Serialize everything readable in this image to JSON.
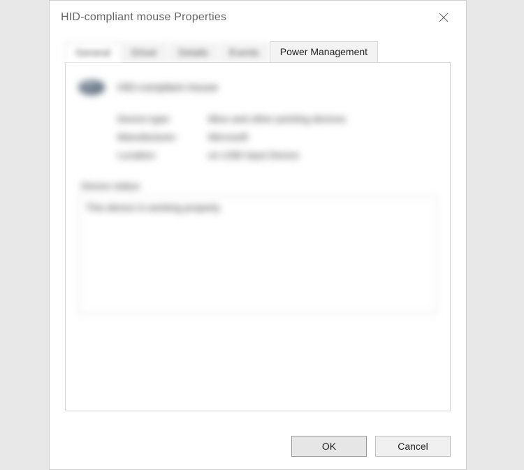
{
  "dialog": {
    "title": "HID-compliant mouse Properties"
  },
  "tabs": [
    {
      "label": "General",
      "active": true
    },
    {
      "label": "Driver",
      "active": false
    },
    {
      "label": "Details",
      "active": false
    },
    {
      "label": "Events",
      "active": false
    },
    {
      "label": "Power Management",
      "active": false
    }
  ],
  "general": {
    "device_name": "HID-compliant mouse",
    "rows": [
      {
        "label": "Device type:",
        "value": "Mice and other pointing devices"
      },
      {
        "label": "Manufacturer:",
        "value": "Microsoft"
      },
      {
        "label": "Location:",
        "value": "on USB Input Device"
      }
    ],
    "status_label": "Device status",
    "status_text": "This device is working properly."
  },
  "buttons": {
    "ok": "OK",
    "cancel": "Cancel"
  }
}
